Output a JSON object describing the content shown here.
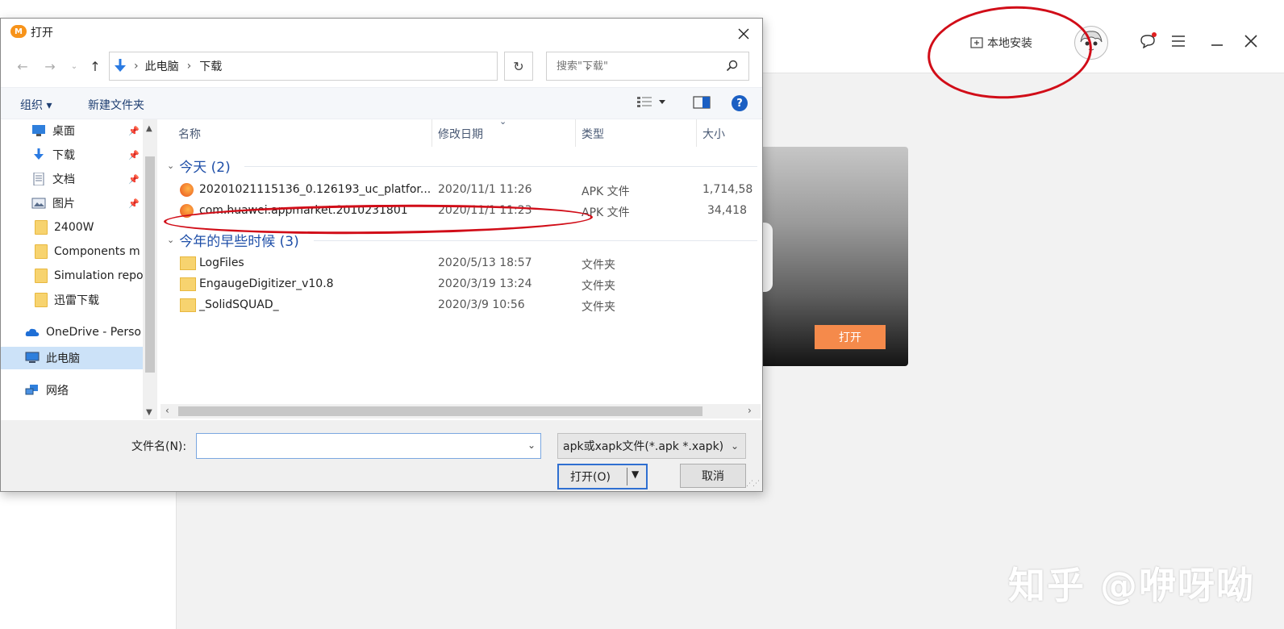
{
  "app": {
    "local_install_label": "本地安装",
    "promo_open_label": "打开",
    "watermark": "知乎 @咿呀呦"
  },
  "dialog": {
    "title": "打开",
    "breadcrumb": [
      "此电脑",
      "下载"
    ],
    "search": {
      "placeholder": "搜索\"下载\""
    },
    "toolbar": {
      "organize": "组织 ▾",
      "new_folder": "新建文件夹"
    },
    "nav": [
      {
        "label": "桌面",
        "icon": "desktop-icon",
        "pinned": true
      },
      {
        "label": "下载",
        "icon": "download-icon",
        "pinned": true
      },
      {
        "label": "文档",
        "icon": "document-icon",
        "pinned": true
      },
      {
        "label": "图片",
        "icon": "picture-icon",
        "pinned": true
      },
      {
        "label": "2400W",
        "icon": "folder-icon",
        "pinned": false
      },
      {
        "label": "Components m",
        "icon": "folder-icon",
        "pinned": false
      },
      {
        "label": "Simulation repo",
        "icon": "folder-icon",
        "pinned": false
      },
      {
        "label": "迅雷下载",
        "icon": "folder-icon",
        "pinned": false
      },
      {
        "label": "OneDrive - Perso",
        "icon": "cloud-icon",
        "pinned": false
      },
      {
        "label": "此电脑",
        "icon": "computer-icon",
        "pinned": false,
        "selected": true
      },
      {
        "label": "网络",
        "icon": "network-icon",
        "pinned": false
      }
    ],
    "columns": {
      "name": "名称",
      "modified": "修改日期",
      "type": "类型",
      "size": "大小"
    },
    "groups": [
      {
        "label": "今天 (2)",
        "rows": [
          {
            "name": "20201021115136_0.126193_uc_platfor...",
            "date": "2020/11/1 11:26",
            "type": "APK 文件",
            "size": "1,714,58",
            "icon": "apk-file-icon"
          },
          {
            "name": "com.huawei.appmarket.2010231801",
            "date": "2020/11/1 11:23",
            "type": "APK 文件",
            "size": "34,418",
            "icon": "apk-file-icon"
          }
        ]
      },
      {
        "label": "今年的早些时候 (3)",
        "rows": [
          {
            "name": "LogFiles",
            "date": "2020/5/13 18:57",
            "type": "文件夹",
            "size": "",
            "icon": "folder-icon"
          },
          {
            "name": "EngaugeDigitizer_v10.8",
            "date": "2020/3/19 13:24",
            "type": "文件夹",
            "size": "",
            "icon": "folder-icon"
          },
          {
            "name": "_SolidSQUAD_",
            "date": "2020/3/9 10:56",
            "type": "文件夹",
            "size": "",
            "icon": "folder-icon"
          }
        ]
      }
    ],
    "footer": {
      "filename_label": "文件名(N):",
      "filename_value": "",
      "filter": "apk或xapk文件(*.apk *.xapk)",
      "open_label": "打开(O)",
      "cancel_label": "取消"
    }
  }
}
